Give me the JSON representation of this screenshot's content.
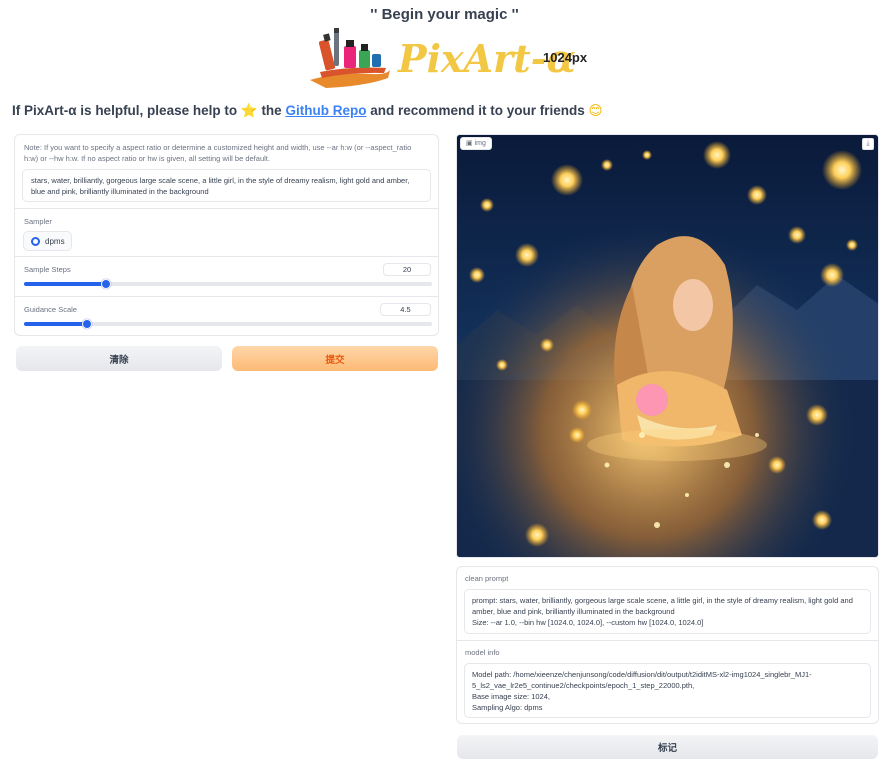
{
  "header": {
    "title": "'' Begin your magic ''",
    "logo_text": "PixArt-α",
    "logo_resolution": "1024px"
  },
  "banner": {
    "prefix": "If PixArt-α is helpful, please help to",
    "star": "⭐",
    "middle": "the",
    "link_text": "Github Repo",
    "suffix": "and recommend it to your friends",
    "smile": "😊"
  },
  "form": {
    "note": "Note: If you want to specify a aspect ratio or determine a customized height and width, use --ar h:w (or --aspect_ratio h:w) or --hw h:w. If no aspect ratio or hw is given, all setting will be default.",
    "prompt_value": "stars, water, brilliantly, gorgeous large scale scene, a little girl, in the style of dreamy realism, light gold and amber, blue and pink, brilliantly illuminated in the background",
    "sampler": {
      "label": "Sampler",
      "selected": "dpms"
    },
    "sample_steps": {
      "label": "Sample Steps",
      "value": "20",
      "fraction": 0.2
    },
    "guidance_scale": {
      "label": "Guidance Scale",
      "value": "4.5",
      "fraction": 0.155
    },
    "clear_label": "清除",
    "submit_label": "提交"
  },
  "output": {
    "image_label": "img",
    "clean_prompt_label": "clean prompt",
    "clean_prompt_line1": "prompt: stars, water, brilliantly, gorgeous large scale scene, a little girl, in the style of dreamy realism, light gold and amber, blue and pink, brilliantly illuminated in the background",
    "clean_prompt_line2": "Size: --ar 1.0, --bin hw [1024.0, 1024.0], --custom hw [1024.0, 1024.0]",
    "model_info_label": "model info",
    "model_info_line1": "Model path: /home/xieenze/chenjunsong/code/diffusion/dit/output/t2iditMS-xl2-img1024_singlebr_MJ1-5_ls2_vae_lr2e5_continue2/checkpoints/epoch_1_step_22000.pth,",
    "model_info_line2": "Base image size: 1024,",
    "model_info_line3": "Sampling Algo: dpms",
    "flag_label": "标记"
  },
  "colors": {
    "accent": "#2563eb",
    "submit_bg": "#fdba74",
    "submit_text": "#ea580c",
    "link": "#3b82f6",
    "logo_yellow": "#f2c744"
  }
}
